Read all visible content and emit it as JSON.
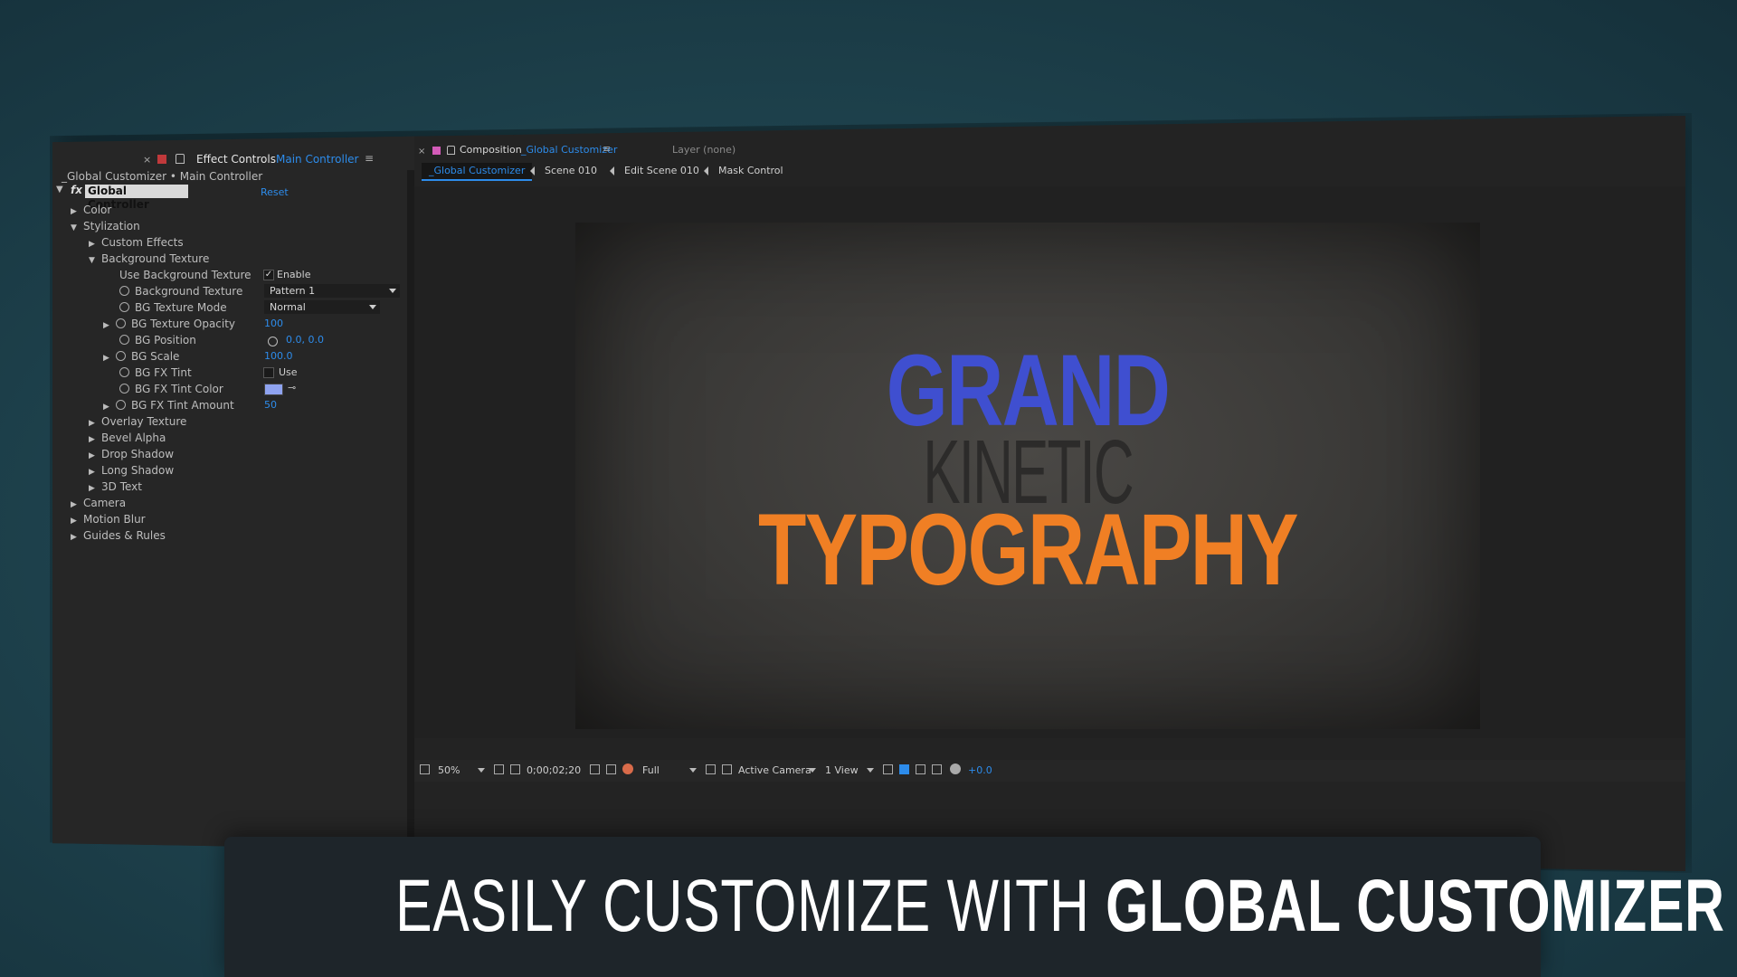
{
  "effect_controls": {
    "tab_title": "Effect Controls",
    "tab_layer": "Main Controller",
    "breadcrumb": "_Global Customizer • Main Controller",
    "effect_label": "fx",
    "effect_name": "Global Controller",
    "reset_label": "Reset",
    "tree": {
      "color": "Color",
      "stylization": "Stylization",
      "custom_effects": "Custom Effects",
      "background_texture": "Background Texture",
      "use_bg_texture": "Use Background Texture",
      "use_bg_texture_value": "Enable",
      "bg_texture": "Background Texture",
      "bg_texture_value": "Pattern 1",
      "bg_texture_mode": "BG Texture Mode",
      "bg_texture_mode_value": "Normal",
      "bg_texture_opacity": "BG Texture Opacity",
      "bg_texture_opacity_value": "100",
      "bg_position": "BG Position",
      "bg_position_value": "0.0, 0.0",
      "bg_scale": "BG Scale",
      "bg_scale_value": "100.0",
      "bg_fx_tint": "BG FX Tint",
      "bg_fx_tint_value": "Use",
      "bg_fx_tint_color": "BG FX Tint Color",
      "bg_fx_tint_color_hex": "#8fa3f0",
      "bg_fx_tint_amount": "BG FX Tint Amount",
      "bg_fx_tint_amount_value": "50",
      "overlay_texture": "Overlay Texture",
      "bevel_alpha": "Bevel Alpha",
      "drop_shadow": "Drop Shadow",
      "long_shadow": "Long Shadow",
      "text_3d": "3D Text",
      "camera": "Camera",
      "motion_blur": "Motion Blur",
      "guides_rules": "Guides & Rules"
    }
  },
  "composition": {
    "tab_title": "Composition",
    "tab_comp": "_Global Customizer",
    "layer_tab": "Layer (none)",
    "flow": [
      "_Global Customizer",
      "Scene 010",
      "Edit Scene 010",
      "Mask Control"
    ],
    "preview": {
      "line1": "GRAND",
      "line2": "KINETIC",
      "line3": "TYPOGRAPHY",
      "color1": "#3f4fd0",
      "color3": "#f07f24"
    },
    "toolbar": {
      "zoom": "50%",
      "timecode": "0;00;02;20",
      "resolution": "Full",
      "camera": "Active Camera",
      "views": "1 View",
      "exposure": "+0.0"
    }
  },
  "caption": {
    "normal_part": "EASILY CUSTOMIZE WITH",
    "bold_part": "GLOBAL CUSTOMIZER"
  }
}
